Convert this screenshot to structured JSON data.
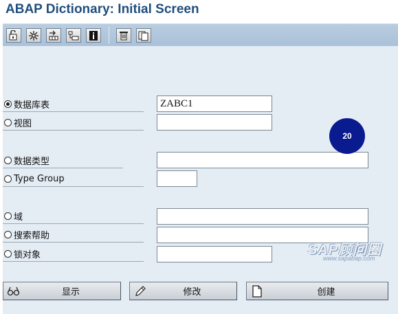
{
  "window": {
    "title": "ABAP Dictionary: Initial Screen"
  },
  "toolbar": {
    "buttons": [
      {
        "icon": "display-change-icon"
      },
      {
        "icon": "where-used-icon"
      },
      {
        "icon": "transport-icon"
      },
      {
        "icon": "object-list-icon"
      },
      {
        "icon": "info-icon"
      },
      {
        "icon": "delete-icon"
      },
      {
        "icon": "copy-icon"
      }
    ]
  },
  "options": [
    {
      "label": "数据库表",
      "selected": true,
      "value": "ZABC1"
    },
    {
      "label": "视图",
      "selected": false,
      "value": ""
    },
    {
      "label": "数据类型",
      "selected": false,
      "value": ""
    },
    {
      "label": "Type Group",
      "selected": false,
      "value": ""
    },
    {
      "label": "域",
      "selected": false,
      "value": ""
    },
    {
      "label": "搜索帮助",
      "selected": false,
      "value": ""
    },
    {
      "label": "锁对象",
      "selected": false,
      "value": ""
    }
  ],
  "badge": {
    "text": "20",
    "color": "#0a1a8f"
  },
  "actions": {
    "display": {
      "label": "显示",
      "icon": "glasses-icon"
    },
    "change": {
      "label": "修改",
      "icon": "pencil-icon"
    },
    "create": {
      "label": "创建",
      "icon": "new-document-icon"
    }
  },
  "watermark": {
    "text": "SAP顾问圈",
    "url": "www.sapabap.com"
  },
  "colors": {
    "title": "#1f4e7d",
    "toolbar": "#b0c6dc",
    "canvas": "#e4ecf4"
  }
}
